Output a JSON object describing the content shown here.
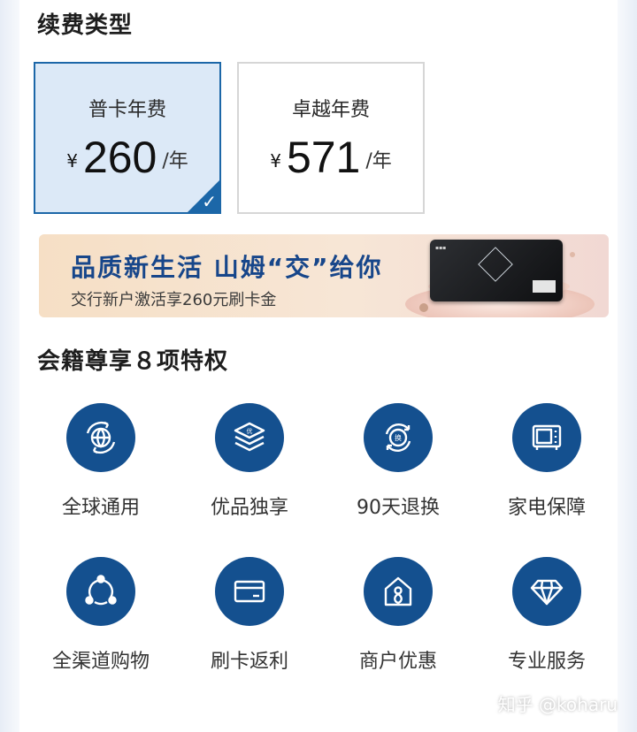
{
  "renewal": {
    "title": "续费类型",
    "plans": [
      {
        "name": "普卡年费",
        "currency": "¥",
        "price": "260",
        "unit": "/年",
        "selected": true
      },
      {
        "name": "卓越年费",
        "currency": "¥",
        "price": "571",
        "unit": "/年",
        "selected": false
      }
    ],
    "check_icon": "✓"
  },
  "banner": {
    "headline": "品质新生活  山姆“交”给你",
    "subtitle": "交行新户激活享260元刷卡金"
  },
  "benefits": {
    "title": "会籍尊享８项特权",
    "items": [
      {
        "label": "全球通用",
        "icon": "globe-icon"
      },
      {
        "label": "优品独享",
        "icon": "layers-icon"
      },
      {
        "label": "90天退换",
        "icon": "exchange-icon"
      },
      {
        "label": "家电保障",
        "icon": "appliance-icon"
      },
      {
        "label": "全渠道购物",
        "icon": "network-icon"
      },
      {
        "label": "刷卡返利",
        "icon": "credit-card-icon"
      },
      {
        "label": "商户优惠",
        "icon": "store-icon"
      },
      {
        "label": "专业服务",
        "icon": "diamond-icon"
      }
    ]
  },
  "watermark": "知乎 @koharu",
  "colors": {
    "accent": "#14508f",
    "selected_bg": "#dce9f7",
    "selected_border": "#1c67a8",
    "banner_text": "#17468a"
  }
}
